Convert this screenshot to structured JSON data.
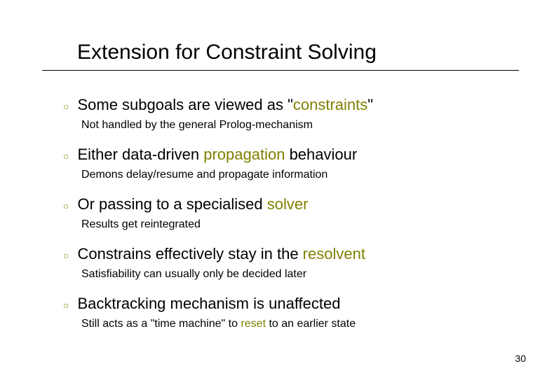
{
  "title": "Extension for Constraint Solving",
  "items": [
    {
      "main_pre": "Some subgoals are viewed as \"",
      "main_hl": "constraints",
      "main_post": "\"",
      "sub_pre": "Not handled by the general Prolog-mechanism",
      "sub_hl": "",
      "sub_post": ""
    },
    {
      "main_pre": "Either data-driven ",
      "main_hl": "propagation",
      "main_post": " behaviour",
      "sub_pre": "Demons delay/resume and propagate information",
      "sub_hl": "",
      "sub_post": ""
    },
    {
      "main_pre": "Or passing to a specialised ",
      "main_hl": "solver",
      "main_post": "",
      "sub_pre": "Results get reintegrated",
      "sub_hl": "",
      "sub_post": ""
    },
    {
      "main_pre": "Constrains effectively stay in the ",
      "main_hl": "resolvent",
      "main_post": "",
      "sub_pre": "Satisfiability can usually only be decided later",
      "sub_hl": "",
      "sub_post": ""
    },
    {
      "main_pre": "Backtracking mechanism is unaffected",
      "main_hl": "",
      "main_post": "",
      "sub_pre": "Still acts as a \"time machine\" to ",
      "sub_hl": "reset",
      "sub_post": " to an earlier state"
    }
  ],
  "bullet_glyph": "○",
  "page_number": "30"
}
